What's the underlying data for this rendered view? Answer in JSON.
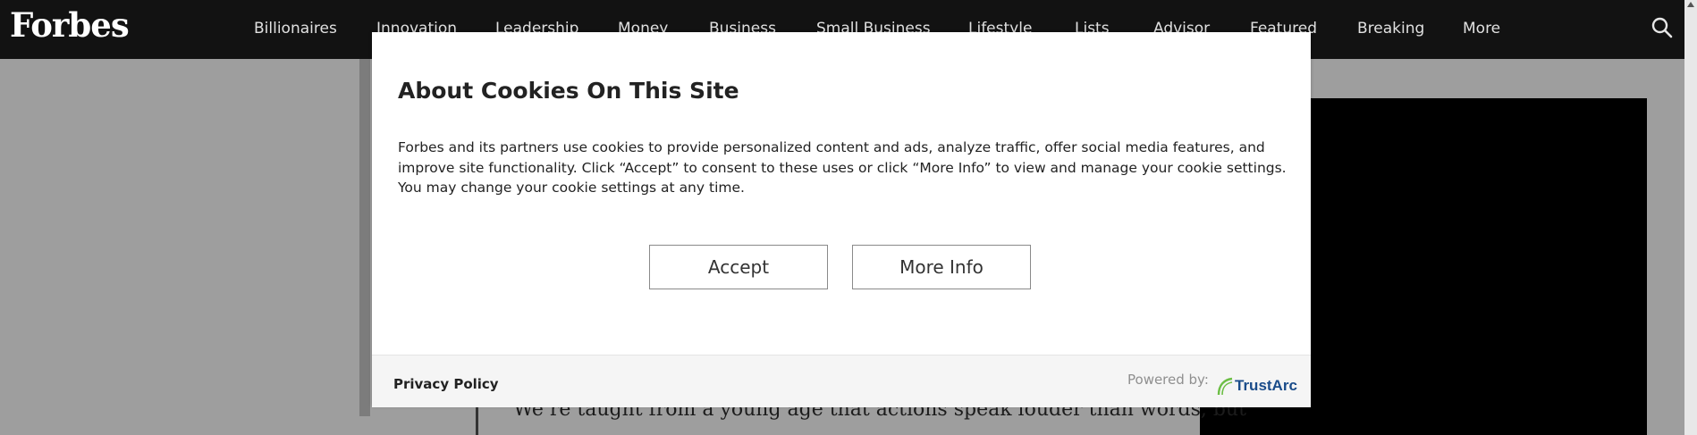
{
  "header": {
    "logo": "Forbes",
    "nav": [
      "Billionaires",
      "Innovation",
      "Leadership",
      "Money",
      "Business",
      "Small Business",
      "Lifestyle",
      "Lists",
      "Advisor",
      "Featured",
      "Breaking",
      "More"
    ],
    "search_icon": "search-icon"
  },
  "article": {
    "snippet": "We’re taught from a young age that actions speak louder than words, but"
  },
  "modal": {
    "title": "About Cookies On This Site",
    "body": "Forbes and its partners use cookies to provide personalized content and ads, analyze traffic, offer social media features, and improve site functionality. Click “Accept” to consent to these uses or click “More Info” to view and manage your cookie settings. You may change your cookie settings at any time.",
    "accept_label": "Accept",
    "more_info_label": "More Info",
    "privacy_label": "Privacy Policy",
    "powered_by": "Powered by:",
    "trustarc_label": "TrustArc"
  },
  "colors": {
    "header_bg": "#121212",
    "overlay_bg": "#9e9e9e",
    "trustarc_blue": "#1a4c8a",
    "trustarc_green": "#6cbe45"
  }
}
